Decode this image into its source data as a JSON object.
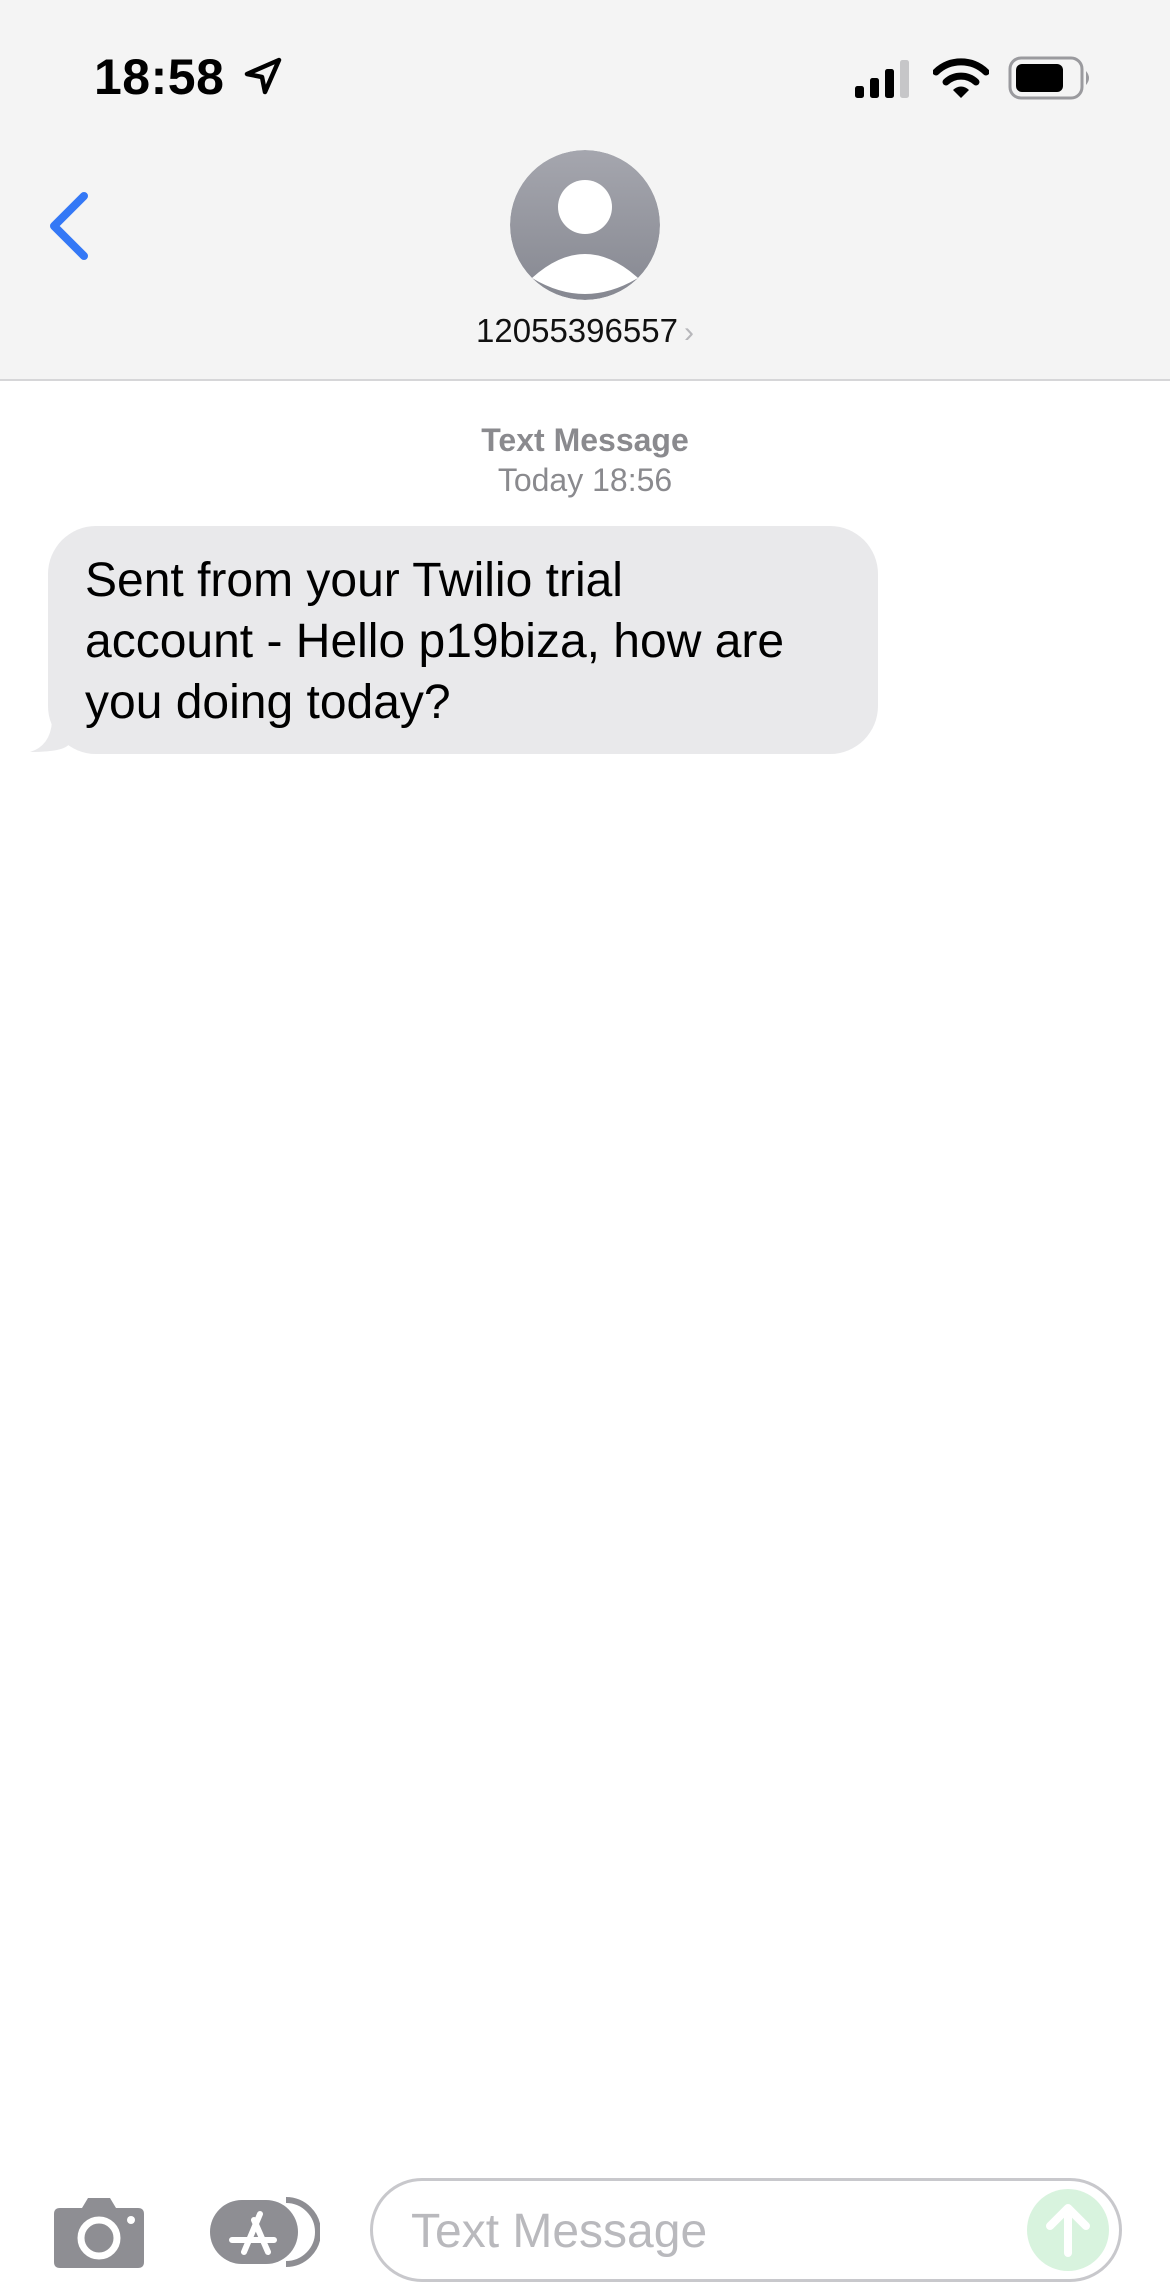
{
  "status_bar": {
    "time": "18:58",
    "icons": [
      "location-arrow-icon",
      "cellular-signal-icon",
      "wifi-icon",
      "battery-icon"
    ]
  },
  "header": {
    "back_icon": "chevron-left-icon",
    "avatar_icon": "person-silhouette-icon",
    "contact": "12055396557",
    "contact_chevron": "›",
    "accent_color": "#3478f6"
  },
  "conversation": {
    "service_label": "Text Message",
    "timestamp": "Today 18:56",
    "messages": [
      {
        "direction": "incoming",
        "lines": [
          "Sent from your Twilio trial",
          "account - Hello p19biza, how are",
          "you doing today?"
        ],
        "bubble_color": "#e9e9eb"
      }
    ]
  },
  "compose_bar": {
    "camera_icon": "camera-icon",
    "apps_icon": "app-store-icon",
    "placeholder": "Text Message",
    "value": "",
    "send_icon": "arrow-up-icon",
    "send_color": "#d8f3de"
  }
}
